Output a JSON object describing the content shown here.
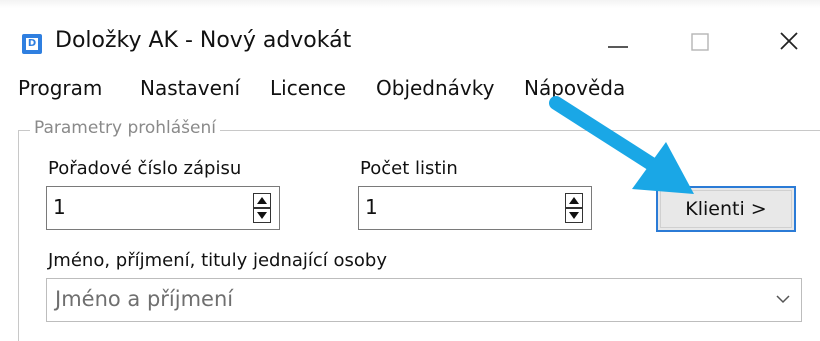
{
  "window": {
    "title": "Doložky AK - Nový advokát",
    "icon": "app-document-icon",
    "icon_letter": "D"
  },
  "menu": {
    "items": [
      {
        "label": "Program"
      },
      {
        "label": "Nastavení"
      },
      {
        "label": "Licence"
      },
      {
        "label": "Objednávky"
      },
      {
        "label": "Nápověda"
      }
    ]
  },
  "params": {
    "group_title": "Parametry prohlášení",
    "order_number": {
      "label": "Pořadové číslo zápisu",
      "value": "1"
    },
    "document_count": {
      "label": "Počet listin",
      "value": "1"
    },
    "clients_button": "Klienti >",
    "person": {
      "label": "Jméno, příjmení, tituly jednající osoby",
      "placeholder": "Jméno a příjmení"
    }
  },
  "colors": {
    "accent": "#2b7bd6",
    "annotation_arrow": "#1aa7e6",
    "app_icon": "#2f7fe0"
  }
}
